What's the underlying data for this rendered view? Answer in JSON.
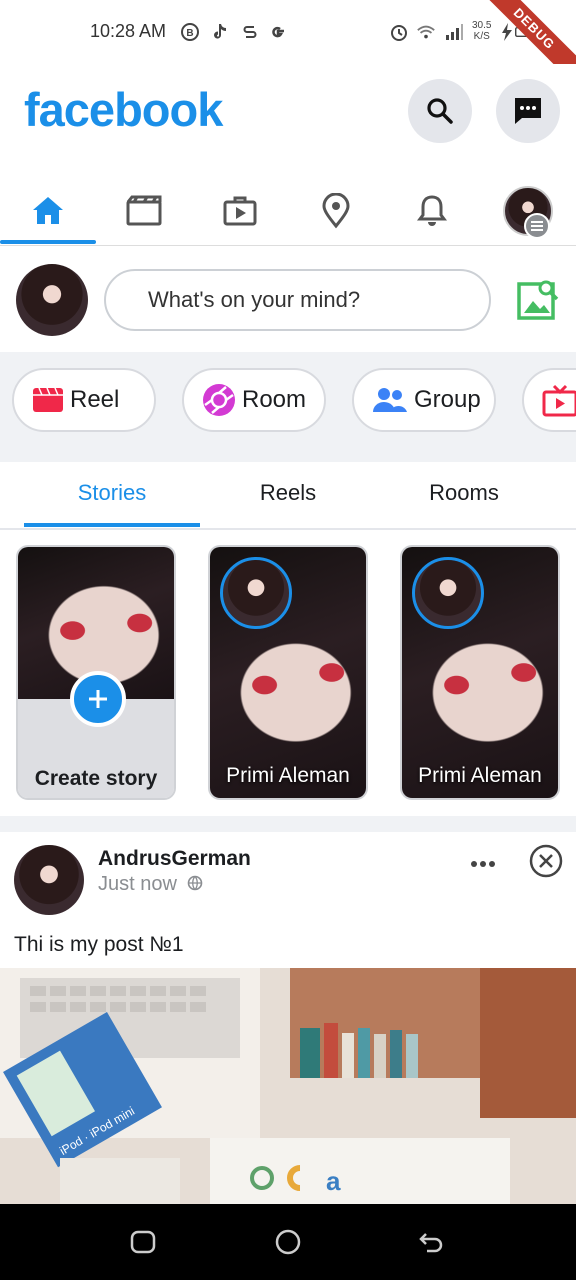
{
  "status_bar": {
    "time": "10:28 AM",
    "left_icons": [
      "b-circle-icon",
      "tiktok-icon",
      "s-icon",
      "google-g-icon"
    ],
    "right_icons": [
      "alarm-icon",
      "wifi-icon",
      "signal-icon",
      "bolt-icon",
      "battery-icon"
    ],
    "speed_value": "30.5",
    "speed_unit": "K/S",
    "debug_label": "DEBUG"
  },
  "header": {
    "logo": "facebook",
    "accent_color": "#1b8fe8"
  },
  "nav_tabs": [
    {
      "name": "home",
      "icon": "home-icon",
      "active": true
    },
    {
      "name": "video",
      "icon": "video-clapper-icon",
      "active": false
    },
    {
      "name": "marketplace",
      "icon": "play-bag-icon",
      "active": false
    },
    {
      "name": "location",
      "icon": "location-pin-icon",
      "active": false
    },
    {
      "name": "notifications",
      "icon": "bell-icon",
      "active": false
    },
    {
      "name": "menu",
      "icon": "profile-menu-icon",
      "active": false
    }
  ],
  "composer": {
    "placeholder": "What's on your mind?",
    "photo_icon": "photo-add-icon"
  },
  "actions": [
    {
      "label": "Reel",
      "icon": "reel-icon",
      "color": "#f02849"
    },
    {
      "label": "Room",
      "icon": "room-camera-icon",
      "color": "#d33ad3"
    },
    {
      "label": "Group",
      "icon": "group-icon",
      "color": "#3b82f6"
    },
    {
      "label": "",
      "icon": "live-tv-icon",
      "color": "#f02849"
    }
  ],
  "story_tabs": [
    {
      "label": "Stories",
      "active": true
    },
    {
      "label": "Reels",
      "active": false
    },
    {
      "label": "Rooms",
      "active": false
    }
  ],
  "stories": [
    {
      "label": "Create story",
      "type": "create"
    },
    {
      "label": "Primi Aleman",
      "type": "user"
    },
    {
      "label": "Primi Aleman",
      "type": "user"
    }
  ],
  "post": {
    "author": "AndrusGerman",
    "time": "Just now",
    "privacy_icon": "globe-icon",
    "text": "Thi is my post №1"
  }
}
